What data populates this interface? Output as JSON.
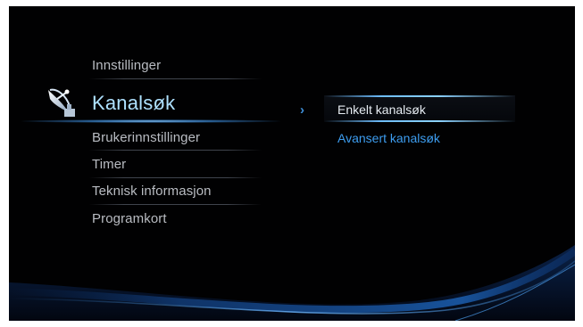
{
  "menu": {
    "items": [
      {
        "label": "Innstillinger"
      },
      {
        "label": "Kanalsøk",
        "selected": true
      },
      {
        "label": "Brukerinnstillinger"
      },
      {
        "label": "Timer"
      },
      {
        "label": "Teknisk informasjon"
      },
      {
        "label": "Programkort"
      }
    ],
    "selected_icon": "satellite-dish-icon"
  },
  "submenu": {
    "arrow_icon": "chevron-right-icon",
    "items": [
      {
        "label": "Enkelt kanalsøk",
        "selected": true
      },
      {
        "label": "Avansert kanalsøk"
      }
    ]
  },
  "colors": {
    "background": "#010102",
    "selected_text": "#aee1ff",
    "submenu_link": "#3d9df0",
    "menu_text": "#b9bcc2"
  }
}
